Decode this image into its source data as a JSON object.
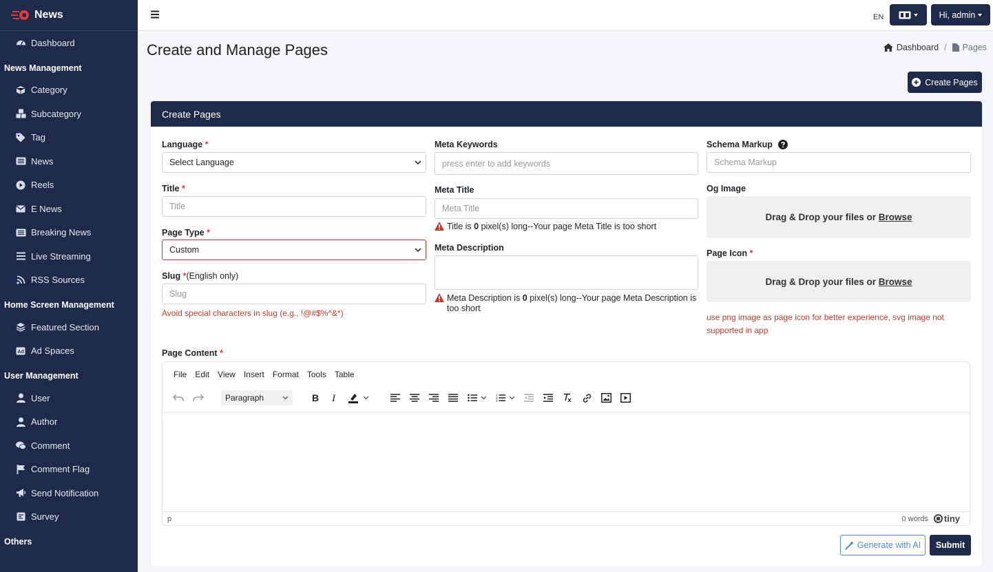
{
  "sidebar": {
    "brand": "News",
    "items": [
      {
        "type": "item",
        "label": "Dashboard",
        "icon": "dashboard-icon"
      },
      {
        "type": "section",
        "label": "News Management"
      },
      {
        "type": "item",
        "label": "Category",
        "icon": "cube-icon"
      },
      {
        "type": "item",
        "label": "Subcategory",
        "icon": "cubes-icon"
      },
      {
        "type": "item",
        "label": "Tag",
        "icon": "tag-icon"
      },
      {
        "type": "item",
        "label": "News",
        "icon": "newspaper-icon"
      },
      {
        "type": "item",
        "label": "Reels",
        "icon": "play-circle-icon"
      },
      {
        "type": "item",
        "label": "E News",
        "icon": "envelope-icon"
      },
      {
        "type": "item",
        "label": "Breaking News",
        "icon": "newspaper-icon"
      },
      {
        "type": "item",
        "label": "Live Streaming",
        "icon": "bars-icon"
      },
      {
        "type": "item",
        "label": "RSS Sources",
        "icon": "rss-icon"
      },
      {
        "type": "section",
        "label": "Home Screen Management"
      },
      {
        "type": "item",
        "label": "Featured Section",
        "icon": "layers-icon"
      },
      {
        "type": "item",
        "label": "Ad Spaces",
        "icon": "ad-icon"
      },
      {
        "type": "section",
        "label": "User Management"
      },
      {
        "type": "item",
        "label": "User",
        "icon": "user-icon"
      },
      {
        "type": "item",
        "label": "Author",
        "icon": "user-icon"
      },
      {
        "type": "item",
        "label": "Comment",
        "icon": "comments-icon"
      },
      {
        "type": "item",
        "label": "Comment Flag",
        "icon": "flag-icon"
      },
      {
        "type": "item",
        "label": "Send Notification",
        "icon": "megaphone-icon"
      },
      {
        "type": "item",
        "label": "Survey",
        "icon": "poll-icon"
      },
      {
        "type": "section",
        "label": "Others"
      }
    ]
  },
  "topbar": {
    "lang_label": "EN",
    "user_button": "Hi, admin"
  },
  "page": {
    "title": "Create and Manage Pages",
    "breadcrumb": {
      "home": "Dashboard",
      "current": "Pages"
    },
    "create_button": "Create Pages"
  },
  "form": {
    "header": "Create Pages",
    "language": {
      "label": "Language",
      "required": "*",
      "value": "Select Language"
    },
    "title": {
      "label": "Title",
      "required": "*",
      "placeholder": "Title"
    },
    "page_type": {
      "label": "Page Type",
      "required": "*",
      "value": "Custom"
    },
    "slug": {
      "label": "Slug",
      "required": "*",
      "note": "(English only)",
      "placeholder": "Slug",
      "error": "Avoid special characters in slug (e.g., !@#$%^&*)"
    },
    "meta_keywords": {
      "label": "Meta Keywords",
      "placeholder": "press enter to add keywords"
    },
    "meta_title": {
      "label": "Meta Title",
      "placeholder": "Meta Title",
      "warn_pre": "Title is",
      "warn_count": "0",
      "warn_post": "pixel(s) long--Your page Meta Title is too short"
    },
    "meta_description": {
      "label": "Meta Description",
      "warn_pre": "Meta Description is",
      "warn_count": "0",
      "warn_post": "pixel(s) long--Your page Meta Description is too short"
    },
    "schema_markup": {
      "label": "Schema Markup",
      "placeholder": "Schema Markup"
    },
    "og_image": {
      "label": "Og Image",
      "drop_text": "Drag & Drop your files or",
      "browse": "Browse"
    },
    "page_icon": {
      "label": "Page Icon",
      "required": "*",
      "drop_text": "Drag & Drop your files or",
      "browse": "Browse",
      "hint": "use png image as page icon for better experience, svg image not supported in app"
    },
    "page_content": {
      "label": "Page Content",
      "required": "*"
    }
  },
  "editor": {
    "menus": [
      "File",
      "Edit",
      "View",
      "Insert",
      "Format",
      "Tools",
      "Table"
    ],
    "block_format": "Paragraph",
    "status_path": "p",
    "word_count": "0 words",
    "brand": "tiny"
  },
  "actions": {
    "generate_ai": "Generate with AI",
    "submit": "Submit"
  },
  "colors": {
    "sidebar_bg": "#1e2a4a",
    "primary": "#1e2a4a",
    "danger": "#dc3545",
    "ai_blue": "#4f8bd6"
  }
}
